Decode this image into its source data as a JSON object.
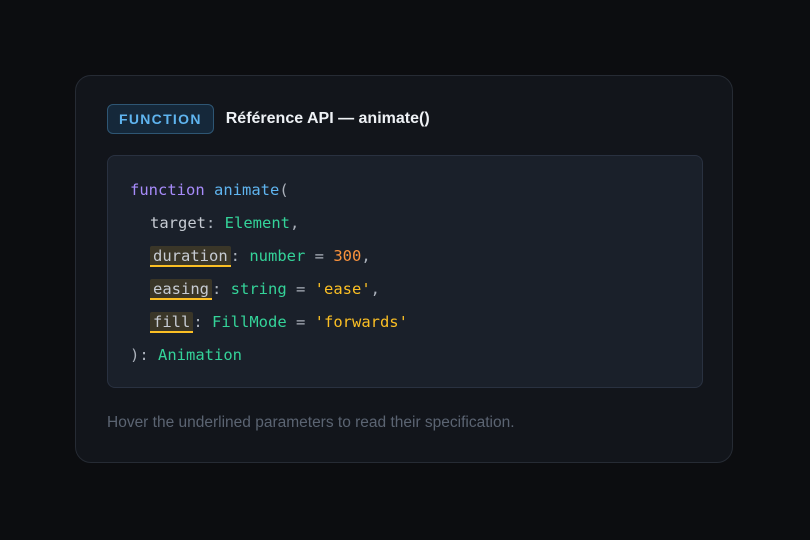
{
  "header": {
    "badge": "FUNCTION",
    "title": "Référence API — animate()"
  },
  "code": {
    "keyword": "function",
    "function_name": "animate",
    "open_paren": "(",
    "params": [
      {
        "name": "target",
        "sep": ": ",
        "type": "Element",
        "default_op": "",
        "default": "",
        "trail": ",",
        "underlined": false
      },
      {
        "name": "duration",
        "sep": ": ",
        "type": "number",
        "default_op": " = ",
        "default": "300",
        "trail": ",",
        "underlined": true
      },
      {
        "name": "easing",
        "sep": ": ",
        "type": "string",
        "default_op": " = ",
        "default": "'ease'",
        "trail": ",",
        "underlined": true
      },
      {
        "name": "fill",
        "sep": ": ",
        "type": "FillMode",
        "default_op": " = ",
        "default": "'forwards'",
        "trail": "",
        "underlined": true
      }
    ],
    "close": "): ",
    "return_type": "Animation"
  },
  "hint": "Hover the underlined parameters to read their specification.",
  "colors": {
    "keyword": "#a78bfa",
    "function": "#5fb4ef",
    "type": "#34d399",
    "number": "#fb923c",
    "string": "#fbbf24",
    "underline": "#fbbf24"
  }
}
